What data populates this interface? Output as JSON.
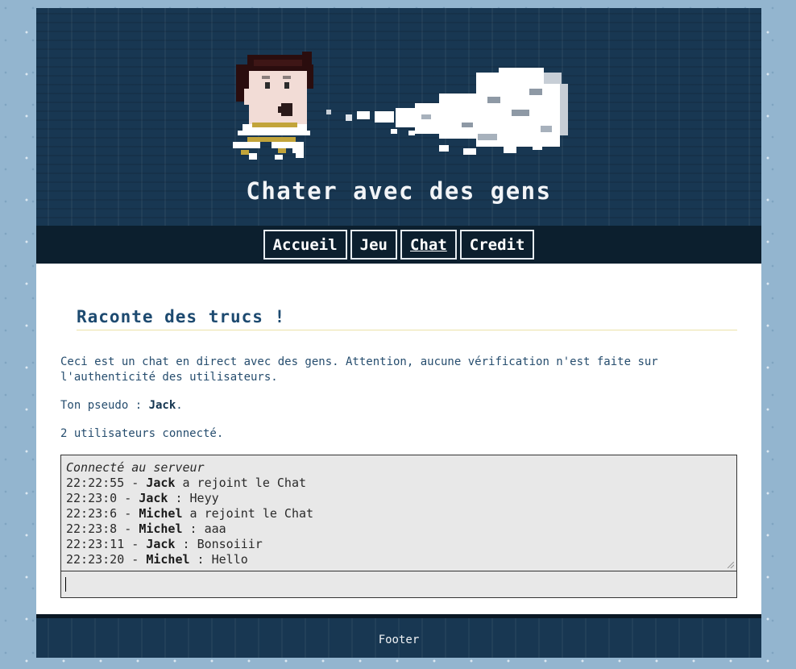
{
  "header": {
    "title": "Chater avec des gens"
  },
  "nav": {
    "items": [
      {
        "label": "Accueil",
        "active": false
      },
      {
        "label": "Jeu",
        "active": false
      },
      {
        "label": "Chat",
        "active": true
      },
      {
        "label": "Credit",
        "active": false
      }
    ]
  },
  "content": {
    "section_title": "Raconte des trucs !",
    "intro": "Ceci est un chat en direct avec des gens. Attention, aucune vérification n'est faite sur l'authenticité des utilisateurs.",
    "pseudo_prefix": "Ton pseudo : ",
    "pseudo": "Jack",
    "pseudo_suffix": ".",
    "users_count_text": "2 utilisateurs connecté."
  },
  "chat": {
    "status": "Connecté au serveur",
    "messages": [
      {
        "time": "22:22:55",
        "user": "Jack",
        "text": "a rejoint le Chat",
        "kind": "event"
      },
      {
        "time": "22:23:0",
        "user": "Jack",
        "text": "Heyy",
        "kind": "message"
      },
      {
        "time": "22:23:6",
        "user": "Michel",
        "text": "a rejoint le Chat",
        "kind": "event"
      },
      {
        "time": "22:23:8",
        "user": "Michel",
        "text": "aaa",
        "kind": "message"
      },
      {
        "time": "22:23:11",
        "user": "Jack",
        "text": "Bonsoiiir",
        "kind": "message"
      },
      {
        "time": "22:23:20",
        "user": "Michel",
        "text": "Hello",
        "kind": "message"
      }
    ],
    "input_value": ""
  },
  "footer": {
    "text": "Footer"
  },
  "colors": {
    "header_bg": "#183752",
    "nav_bg": "#0c1f2e",
    "page_bg": "#93b5cf",
    "title_color": "#1d4a70",
    "text_color": "#264d6e"
  }
}
